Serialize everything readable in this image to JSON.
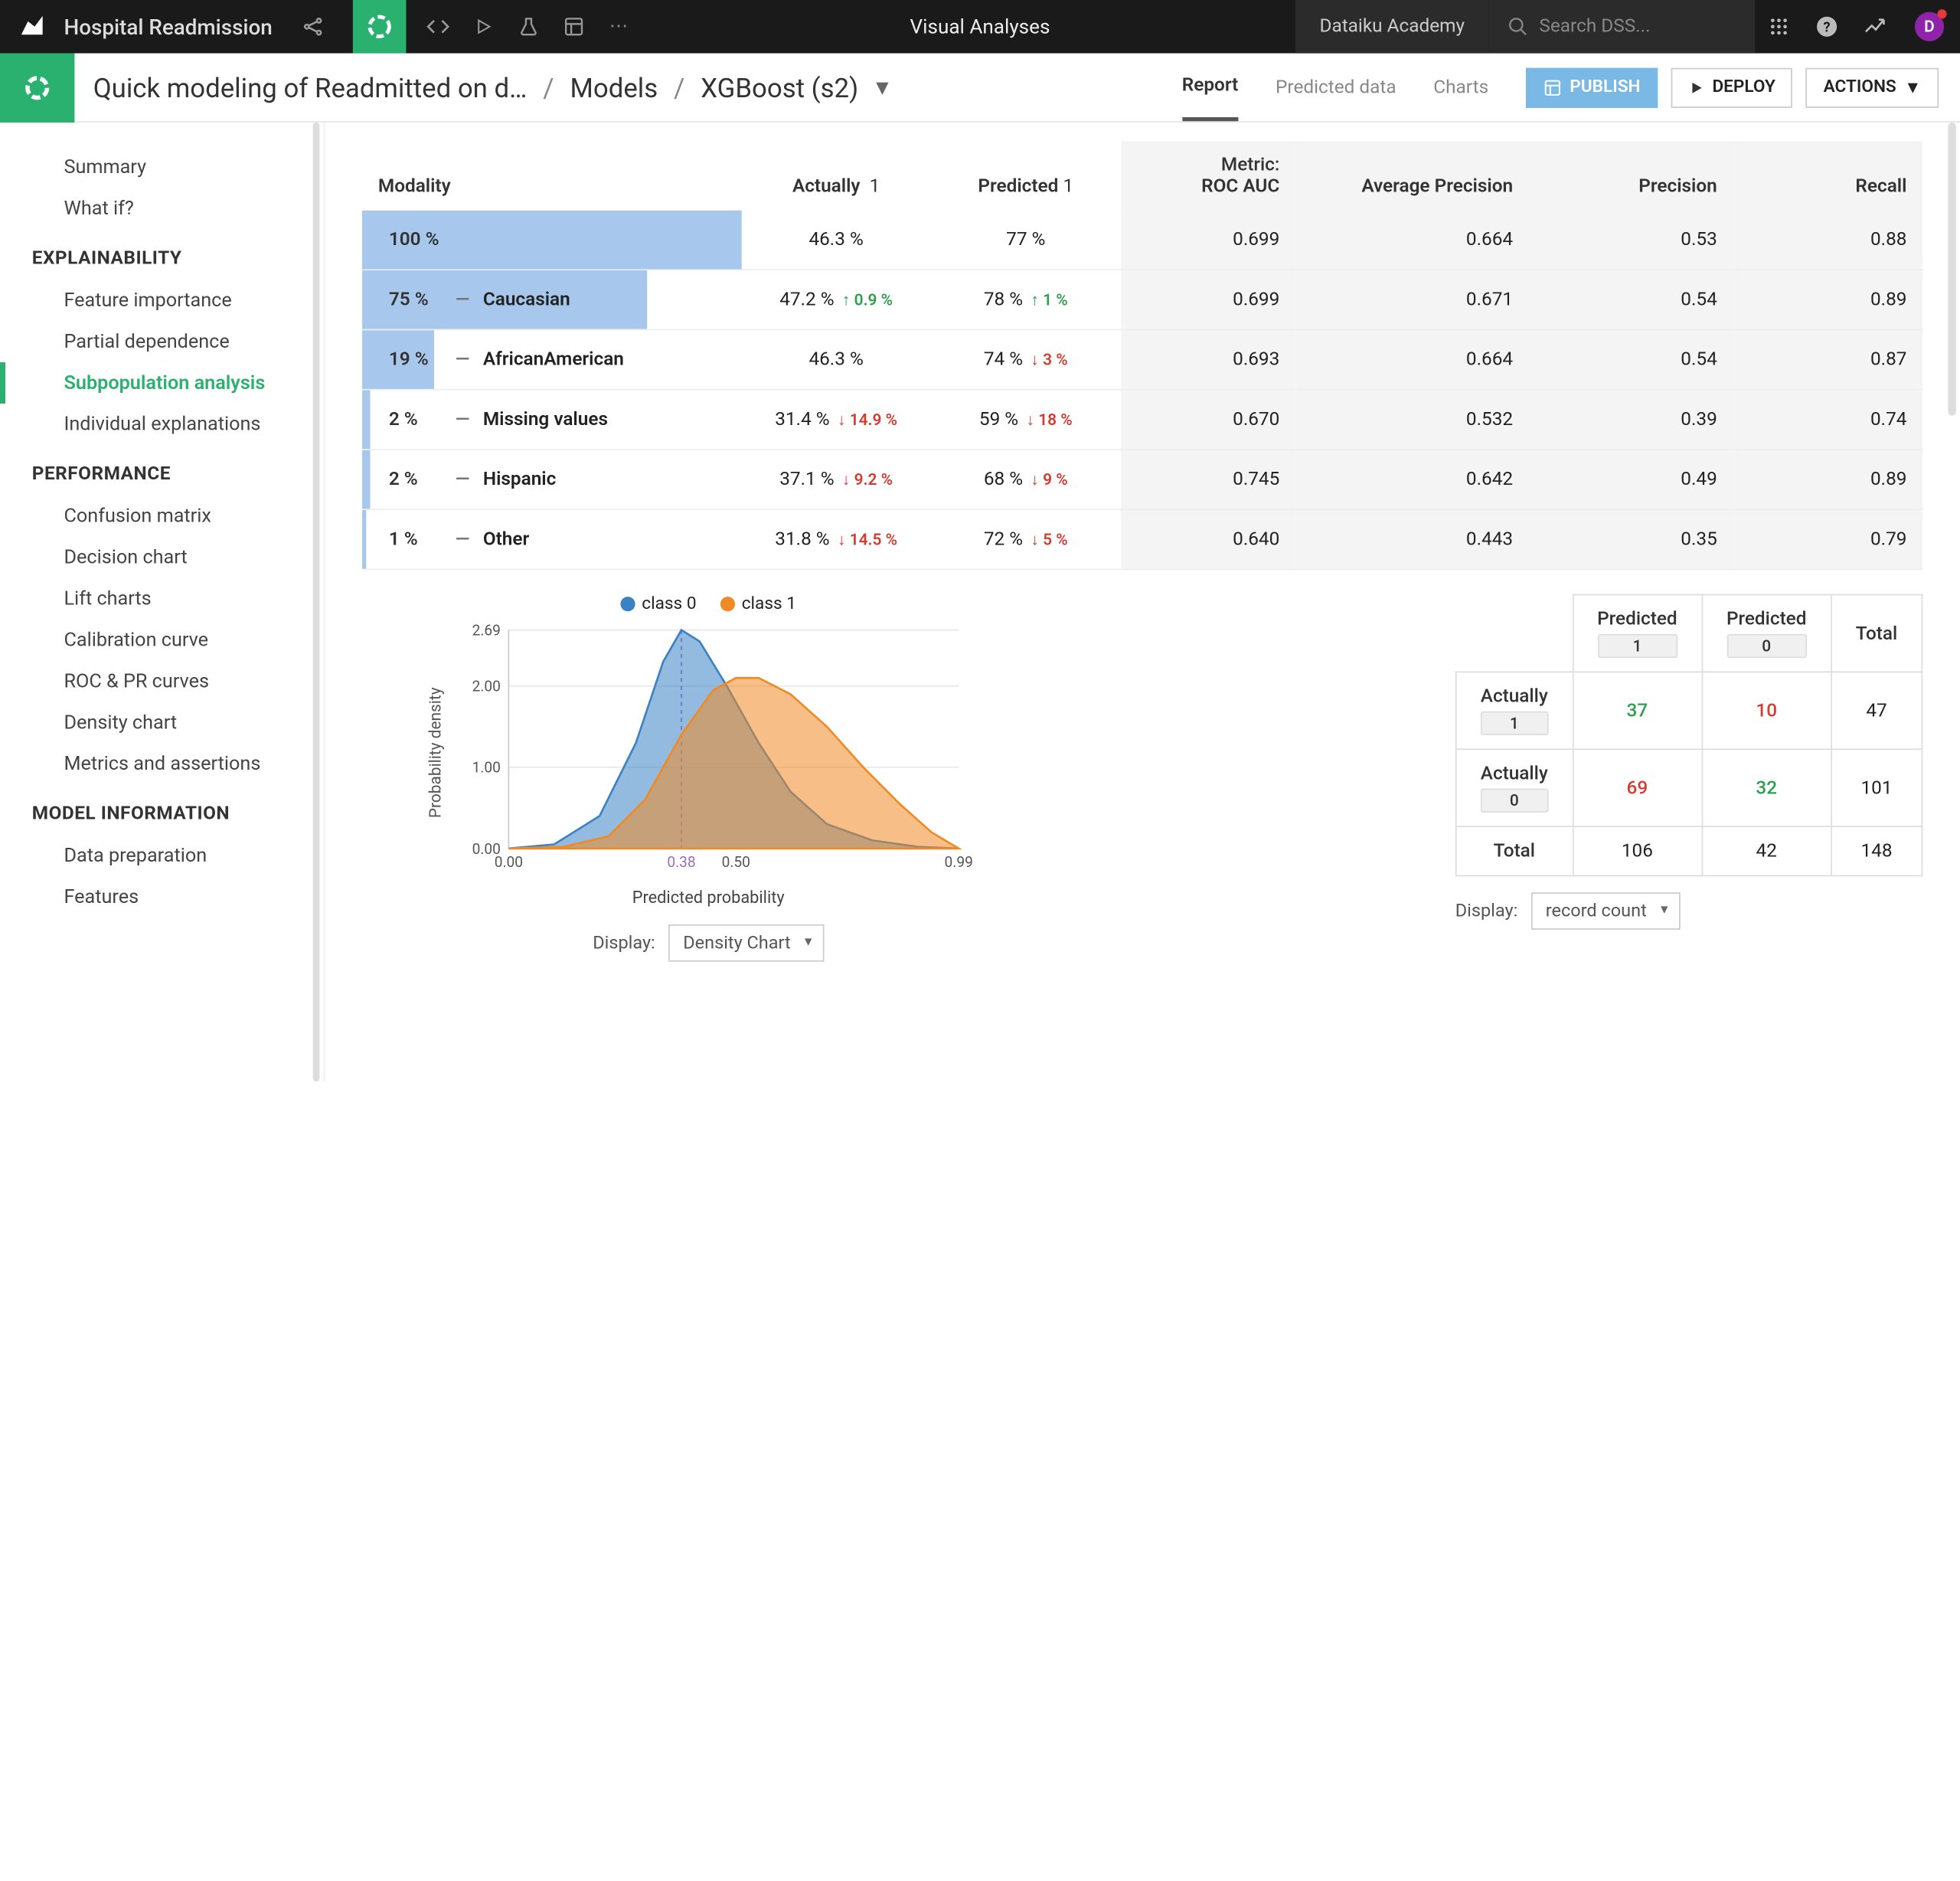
{
  "top": {
    "project": "Hospital Readmission",
    "center": "Visual Analyses",
    "academy": "Dataiku Academy",
    "search_placeholder": "Search DSS...",
    "avatar_initial": "D"
  },
  "breadcrumb": {
    "flow": "Quick modeling of Readmitted on d…",
    "models": "Models",
    "model": "XGBoost (s2)"
  },
  "tabs": [
    "Report",
    "Predicted data",
    "Charts"
  ],
  "active_tab": "Report",
  "buttons": {
    "publish": "PUBLISH",
    "deploy": "DEPLOY",
    "actions": "ACTIONS"
  },
  "sidebar": {
    "general": [
      "Summary",
      "What if?"
    ],
    "sections": [
      {
        "title": "EXPLAINABILITY",
        "items": [
          "Feature importance",
          "Partial dependence",
          "Subpopulation analysis",
          "Individual explanations"
        ],
        "active": "Subpopulation analysis"
      },
      {
        "title": "PERFORMANCE",
        "items": [
          "Confusion matrix",
          "Decision chart",
          "Lift charts",
          "Calibration curve",
          "ROC & PR curves",
          "Density chart",
          "Metrics and assertions"
        ]
      },
      {
        "title": "MODEL INFORMATION",
        "items": [
          "Data preparation",
          "Features"
        ]
      }
    ]
  },
  "table": {
    "headers": {
      "modality": "Modality",
      "actually": "Actually",
      "actually_val": "1",
      "predicted": "Predicted",
      "predicted_val": "1",
      "metric_pre": "Metric:",
      "metric": "ROC AUC",
      "avgp": "Average Precision",
      "prec": "Precision",
      "recall": "Recall"
    },
    "rows": [
      {
        "pct": "100 %",
        "name": "",
        "barw": 100,
        "hl": true,
        "act": "46.3 %",
        "actd": "",
        "pred": "77 %",
        "predd": "",
        "auc": "0.699",
        "ap": "0.664",
        "p": "0.53",
        "r": "0.88"
      },
      {
        "pct": "75 %",
        "name": "Caucasian",
        "barw": 75,
        "act": "47.2 %",
        "actd": "↑ 0.9 %",
        "actdir": "up",
        "pred": "78 %",
        "predd": "↑ 1 %",
        "preddir": "up",
        "auc": "0.699",
        "ap": "0.671",
        "p": "0.54",
        "r": "0.89"
      },
      {
        "pct": "19 %",
        "name": "AfricanAmerican",
        "barw": 19,
        "act": "46.3 %",
        "actd": "",
        "pred": "74 %",
        "predd": "↓ 3 %",
        "preddir": "dn",
        "auc": "0.693",
        "ap": "0.664",
        "p": "0.54",
        "r": "0.87"
      },
      {
        "pct": "2 %",
        "name": "Missing values",
        "barw": 2,
        "act": "31.4 %",
        "actd": "↓ 14.9 %",
        "actdir": "dn",
        "pred": "59 %",
        "predd": "↓ 18 %",
        "preddir": "dn",
        "auc": "0.670",
        "ap": "0.532",
        "p": "0.39",
        "r": "0.74"
      },
      {
        "pct": "2 %",
        "name": "Hispanic",
        "barw": 2,
        "act": "37.1 %",
        "actd": "↓ 9.2 %",
        "actdir": "dn",
        "pred": "68 %",
        "predd": "↓ 9 %",
        "preddir": "dn",
        "auc": "0.745",
        "ap": "0.642",
        "p": "0.49",
        "r": "0.89"
      },
      {
        "pct": "1 %",
        "name": "Other",
        "barw": 1,
        "act": "31.8 %",
        "actd": "↓ 14.5 %",
        "actdir": "dn",
        "pred": "72 %",
        "predd": "↓ 5 %",
        "preddir": "dn",
        "auc": "0.640",
        "ap": "0.443",
        "p": "0.35",
        "r": "0.79"
      }
    ]
  },
  "chart_data": {
    "type": "area",
    "title": "",
    "xlabel": "Predicted probability",
    "ylabel": "Probability density",
    "xlim": [
      0,
      0.99
    ],
    "ylim": [
      0,
      2.69
    ],
    "xticks": [
      "0.00",
      "0.38",
      "0.50",
      "0.99"
    ],
    "yticks": [
      "0.00",
      "1.00",
      "2.00",
      "2.69"
    ],
    "marker_x": 0.38,
    "series": [
      {
        "name": "class 0",
        "color": "#3b82c4",
        "x": [
          0.0,
          0.1,
          0.2,
          0.28,
          0.34,
          0.38,
          0.42,
          0.48,
          0.55,
          0.62,
          0.7,
          0.8,
          0.9,
          0.99
        ],
        "y": [
          0.0,
          0.05,
          0.4,
          1.3,
          2.3,
          2.69,
          2.55,
          2.0,
          1.3,
          0.7,
          0.3,
          0.1,
          0.02,
          0.0
        ]
      },
      {
        "name": "class 1",
        "color": "#f08a24",
        "x": [
          0.0,
          0.12,
          0.22,
          0.3,
          0.38,
          0.45,
          0.5,
          0.55,
          0.62,
          0.7,
          0.78,
          0.86,
          0.93,
          0.99
        ],
        "y": [
          0.0,
          0.02,
          0.15,
          0.6,
          1.4,
          1.95,
          2.1,
          2.1,
          1.9,
          1.5,
          1.0,
          0.55,
          0.2,
          0.0
        ]
      }
    ]
  },
  "confusion": {
    "pred1": "Predicted",
    "pred1v": "1",
    "pred0": "Predicted",
    "pred0v": "0",
    "total": "Total",
    "act1": "Actually",
    "act1v": "1",
    "act0": "Actually",
    "act0v": "0",
    "cells": [
      [
        "37",
        "10",
        "47"
      ],
      [
        "69",
        "32",
        "101"
      ],
      [
        "106",
        "42",
        "148"
      ]
    ],
    "row_total": "Total"
  },
  "display": {
    "label": "Display:",
    "chart": "Density Chart",
    "conf": "record count"
  }
}
